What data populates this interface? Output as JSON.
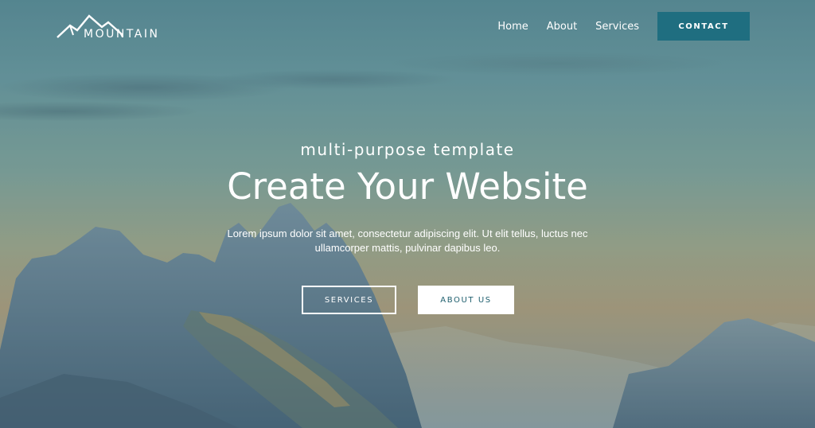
{
  "brand": {
    "logo_text": "MOUNTAIN",
    "logo_icon": "mountain-peaks-icon"
  },
  "nav": {
    "items": [
      {
        "label": "Home"
      },
      {
        "label": "About"
      },
      {
        "label": "Services"
      }
    ],
    "contact_label": "CONTACT"
  },
  "hero": {
    "subtitle": "multi-purpose template",
    "title": "Create Your Website",
    "description": "Lorem ipsum dolor sit amet, consectetur adipiscing elit. Ut elit tellus, luctus nec ullamcorper mattis, pulvinar dapibus leo.",
    "services_button": "SERVICES",
    "about_button": "ABOUT US"
  },
  "colors": {
    "accent": "#1f6e80",
    "text": "#ffffff",
    "about_button_text": "#1f5f6e"
  }
}
